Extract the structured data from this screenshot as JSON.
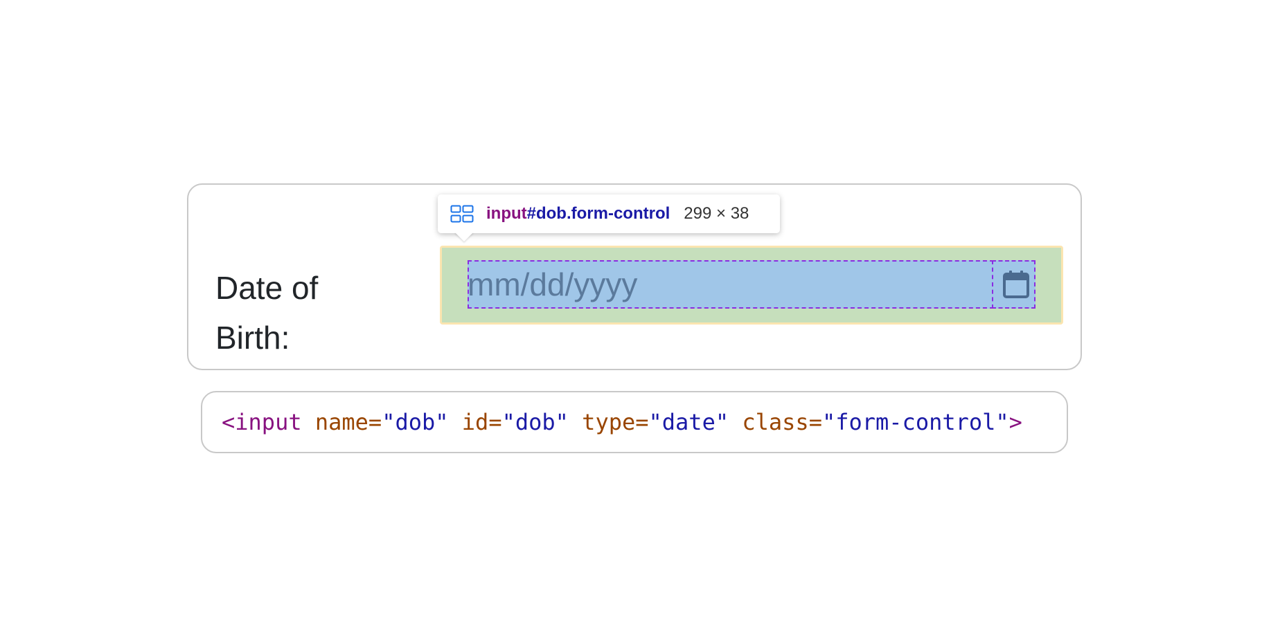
{
  "form": {
    "label": "Date of Birth:",
    "input": {
      "placeholder": "mm/dd/yyyy"
    }
  },
  "tooltip": {
    "tag": "input",
    "selector": "#dob.form-control",
    "size": "299 × 38"
  },
  "code": {
    "open": "<input",
    "attrs": [
      {
        "name": " name=",
        "value": "\"dob\""
      },
      {
        "name": " id=",
        "value": "\"dob\""
      },
      {
        "name": " type=",
        "value": "\"date\""
      },
      {
        "name": " class=",
        "value": "\"form-control\""
      }
    ],
    "close": ">"
  },
  "colors": {
    "margin": "#fbe5b0",
    "padding": "#c6dfbc",
    "content": "#a0c6e8",
    "outline": "#8a2be2"
  },
  "icons": {
    "tooltip": "flex-layout-icon",
    "picker": "calendar-icon"
  }
}
